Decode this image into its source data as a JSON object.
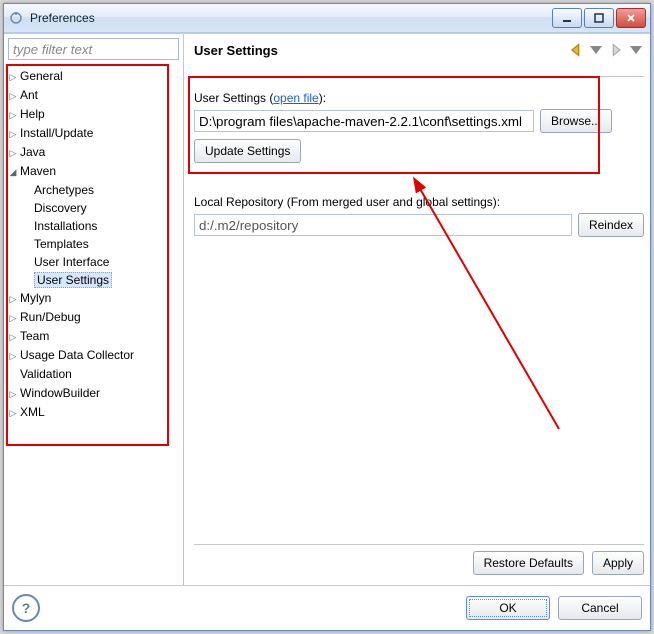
{
  "window": {
    "title": "Preferences"
  },
  "filter_placeholder": "type filter text",
  "tree": {
    "general": "General",
    "ant": "Ant",
    "help": "Help",
    "install_update": "Install/Update",
    "java": "Java",
    "maven": "Maven",
    "maven_children": {
      "archetypes": "Archetypes",
      "discovery": "Discovery",
      "installations": "Installations",
      "templates": "Templates",
      "user_interface": "User Interface",
      "user_settings": "User Settings"
    },
    "mylyn": "Mylyn",
    "run_debug": "Run/Debug",
    "team": "Team",
    "usage": "Usage Data Collector",
    "validation": "Validation",
    "windowbuilder": "WindowBuilder",
    "xml": "XML"
  },
  "panel": {
    "heading": "User Settings",
    "user_settings_label_prefix": "User Settings (",
    "open_file": "open file",
    "user_settings_label_suffix": "):",
    "settings_path": "D:\\program files\\apache-maven-2.2.1\\conf\\settings.xml",
    "browse": "Browse...",
    "update": "Update Settings",
    "local_repo_label": "Local Repository (From merged user and global settings):",
    "local_repo_value": "d:/.m2/repository",
    "reindex": "Reindex",
    "restore": "Restore Defaults",
    "apply": "Apply"
  },
  "footer": {
    "ok": "OK",
    "cancel": "Cancel",
    "help": "?"
  }
}
